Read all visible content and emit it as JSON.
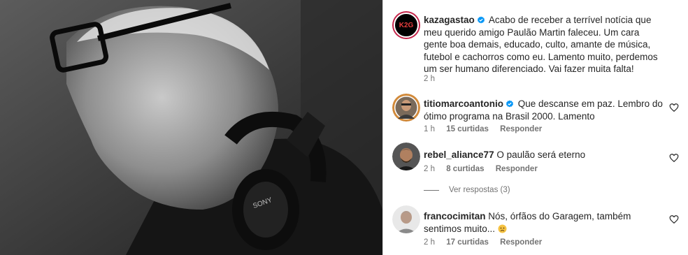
{
  "post": {
    "author": "kazagastao",
    "caption": "Acabo de receber a terrível notícia que meu querido amigo Paulão Martin faleceu. Um cara gente boa demais, educado, culto, amante de música, futebol e cachorros como eu. Lamento muito, perdemos um ser humano diferenciado. Vai fazer muita falta!",
    "time": "2 h",
    "avatar_text": "K2G"
  },
  "comments": [
    {
      "username": "titiomarcoantonio",
      "verified": true,
      "text": "Que descanse em paz. Lembro do ótimo programa na Brasil 2000. Lamento",
      "time": "1 h",
      "likes": "15 curtidas",
      "reply": "Responder"
    },
    {
      "username": "rebel_aliance77",
      "verified": false,
      "text": "O paulão será eterno",
      "time": "2 h",
      "likes": "8 curtidas",
      "reply": "Responder"
    },
    {
      "username": "francocimitan",
      "verified": false,
      "text": "Nós, órfãos do Garagem, também sentimos muito...",
      "time": "2 h",
      "likes": "17 curtidas",
      "reply": "Responder"
    }
  ],
  "view_replies": "Ver respostas (3)",
  "icons": {
    "verified": "verified-badge-icon",
    "heart": "heart-outline-icon",
    "emoji": "sad-face-emoji-icon"
  },
  "colors": {
    "verified": "#0095f6",
    "text": "#262626",
    "secondary": "#737373",
    "avatar_ring": "#d6249f"
  }
}
